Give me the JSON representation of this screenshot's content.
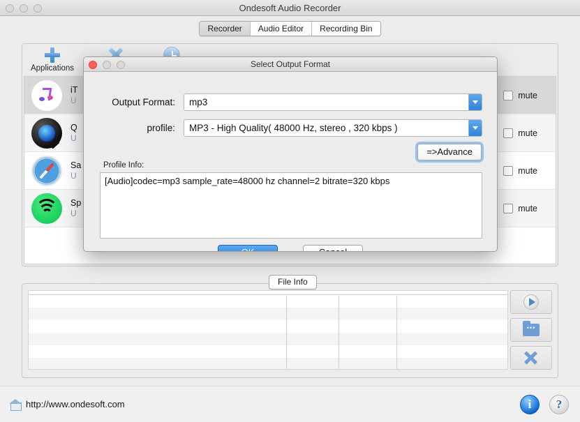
{
  "window": {
    "title": "Ondesoft Audio Recorder",
    "traffic_lights": [
      "close",
      "minimize",
      "zoom"
    ]
  },
  "tabs": [
    {
      "label": "Recorder",
      "active": true
    },
    {
      "label": "Audio Editor",
      "active": false
    },
    {
      "label": "Recording Bin",
      "active": false
    }
  ],
  "recorder": {
    "toolbar": [
      {
        "label": "Applications",
        "icon": "plus-icon"
      },
      {
        "label": "",
        "icon": "x-icon"
      },
      {
        "label": "",
        "icon": "clock-icon"
      }
    ],
    "apps": [
      {
        "name": "iT",
        "status": "U",
        "mute_label": "mute",
        "icon": "itunes-icon",
        "muted": false
      },
      {
        "name": "Q",
        "status": "U",
        "mute_label": "mute",
        "icon": "quicktime-icon",
        "muted": false
      },
      {
        "name": "Sa",
        "status": "U",
        "mute_label": "mute",
        "icon": "safari-icon",
        "muted": false
      },
      {
        "name": "Sp",
        "status": "U",
        "mute_label": "mute",
        "icon": "spotify-icon",
        "muted": false
      }
    ]
  },
  "file_info": {
    "legend": "File Info",
    "columns": [
      "",
      "",
      "",
      ""
    ],
    "rows": [],
    "side_buttons": [
      {
        "name": "play",
        "icon": "play-icon"
      },
      {
        "name": "open-folder",
        "icon": "folder-icon"
      },
      {
        "name": "delete",
        "icon": "x-icon"
      }
    ]
  },
  "status_bar": {
    "home_url": "http://www.ondesoft.com",
    "info_label": "i",
    "help_label": "?"
  },
  "dialog": {
    "title": "Select Output Format",
    "output_format": {
      "label": "Output Format:",
      "value": "mp3"
    },
    "profile": {
      "label": "profile:",
      "value": "MP3 - High Quality( 48000 Hz, stereo , 320 kbps  )"
    },
    "advance_button": "=>Advance",
    "profile_info": {
      "label": "Profile Info:",
      "text": "[Audio]codec=mp3 sample_rate=48000 hz channel=2 bitrate=320 kbps"
    },
    "ok_button": "OK",
    "cancel_button": "Cancel"
  },
  "colors": {
    "accent_blue": "#1d78d8",
    "combo_arrow_blue": "#2f82dc",
    "focus_ring": "#6eaaeb",
    "link_text": "#1b1b1b",
    "sub_text": "#8a9bb4"
  }
}
